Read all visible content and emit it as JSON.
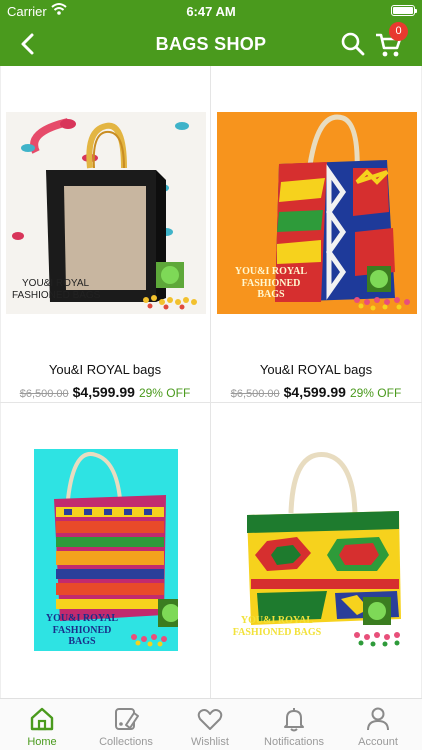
{
  "status_bar": {
    "carrier": "Carrier",
    "time": "6:47 AM"
  },
  "header": {
    "title": "BAGS SHOP",
    "cart_count": "0",
    "accent_color": "#4a9a1d"
  },
  "products": [
    {
      "name": "You&I ROYAL bags",
      "old_price": "$6,500.00",
      "price": "$4,599.99",
      "discount": "29% OFF",
      "image_text": [
        "YOU&I ROYAL",
        "FASHIONED BAGS"
      ]
    },
    {
      "name": "You&I ROYAL bags",
      "old_price": "$6,500.00",
      "price": "$4,599.99",
      "discount": "29% OFF",
      "image_text": [
        "YOU&I ROYAL",
        "FASHIONED",
        "BAGS"
      ]
    },
    {
      "image_text": [
        "YOU&I ROYAL",
        "FASHIONED",
        "BAGS"
      ]
    },
    {
      "image_text": [
        "YOU&I ROYAL",
        "FASHIONED BAGS"
      ]
    }
  ],
  "tabs": [
    {
      "label": "Home",
      "icon": "home-icon",
      "active": true
    },
    {
      "label": "Collections",
      "icon": "collections-icon",
      "active": false
    },
    {
      "label": "Wishlist",
      "icon": "heart-icon",
      "active": false
    },
    {
      "label": "Notifications",
      "icon": "bell-icon",
      "active": false
    },
    {
      "label": "Account",
      "icon": "person-icon",
      "active": false
    }
  ]
}
